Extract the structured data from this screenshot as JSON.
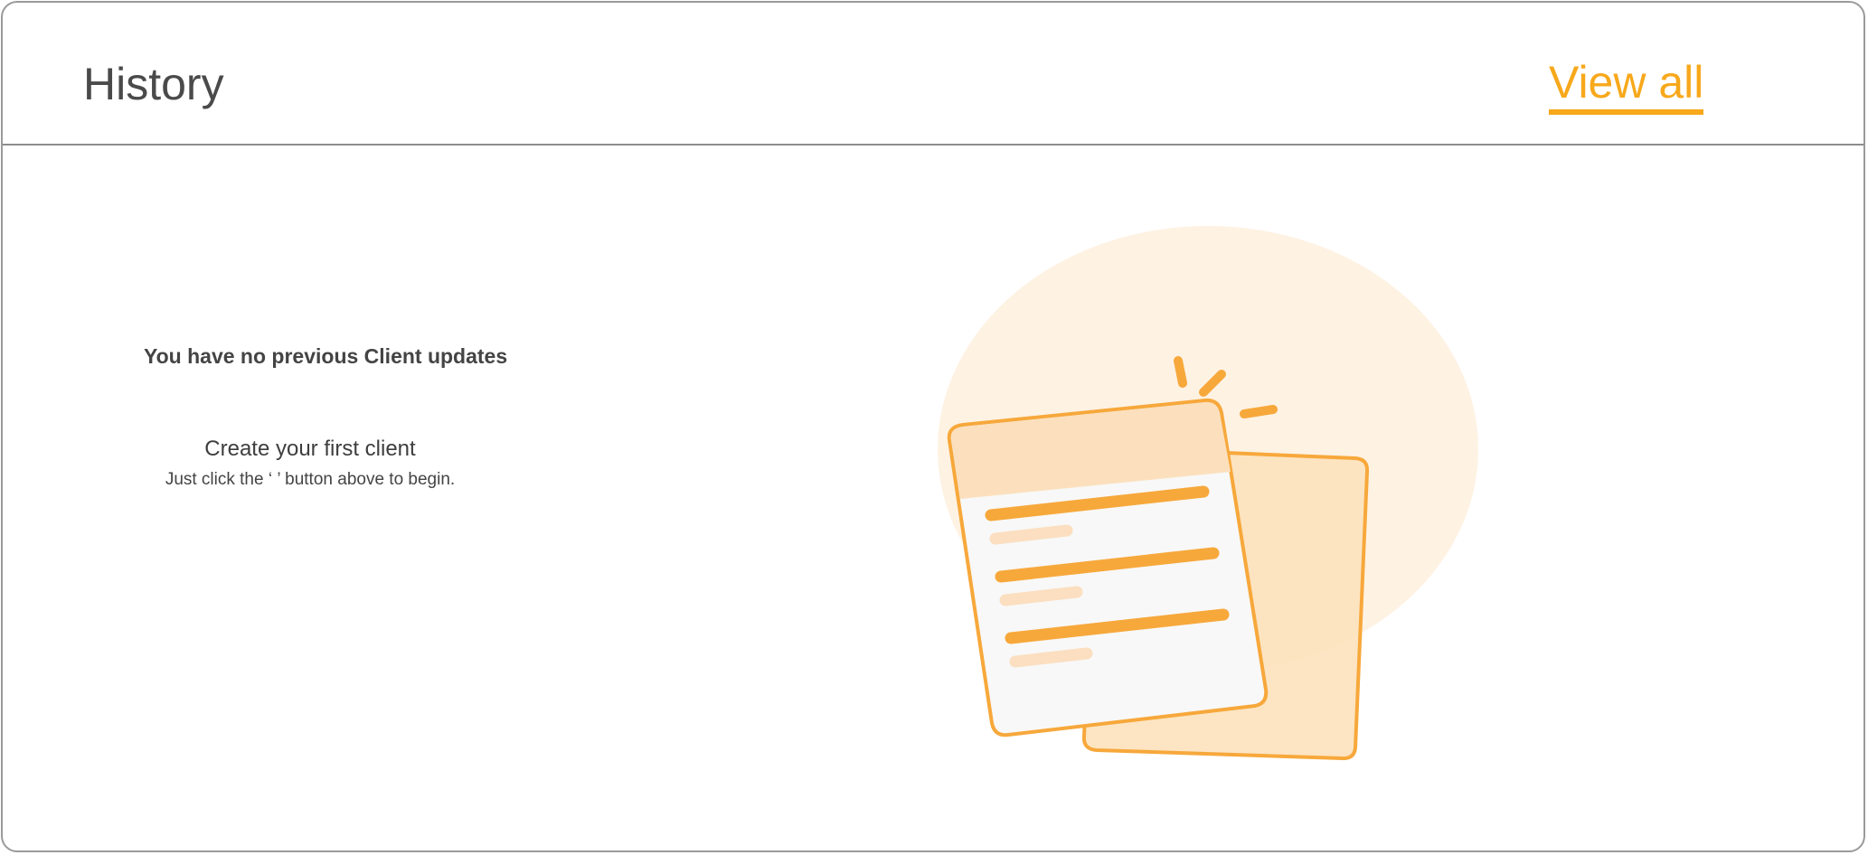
{
  "header": {
    "title": "History",
    "view_all_label": "View all"
  },
  "empty_state": {
    "message": "You have no previous Client  updates",
    "heading": "Create your first client",
    "hint": "Just click the ‘    ’ button above to begin."
  },
  "illustration": {
    "icon": "document-stack-illustration",
    "colors": {
      "accent": "#f7a83b",
      "circle": "#fef2e3",
      "back_doc": "#fde2bd",
      "front_doc": "#f8f8f8",
      "front_header": "#fce0bd",
      "light_line": "#fbdfc0"
    }
  },
  "colors": {
    "link": "#f7a81b",
    "title": "#4a4a4a",
    "border": "#9a9a9a"
  }
}
